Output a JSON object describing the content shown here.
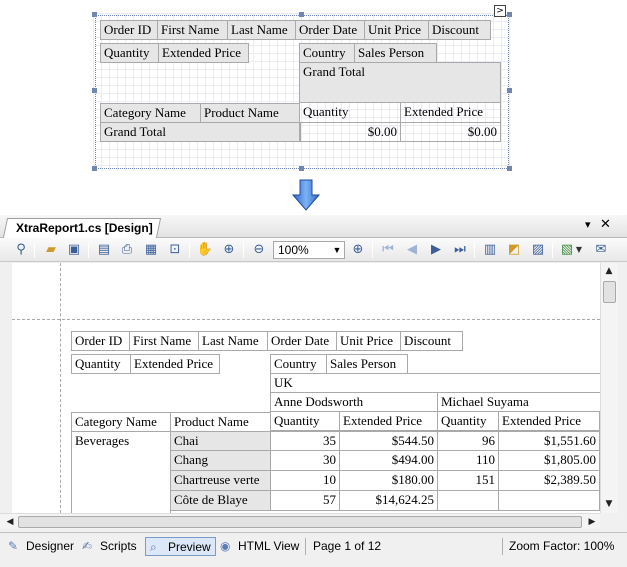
{
  "designer": {
    "table1": [
      "Order ID",
      "First Name",
      "Last Name",
      "Order Date",
      "Unit Price",
      "Discount"
    ],
    "detail_left": [
      "Quantity",
      "Extended Price"
    ],
    "pivot_cols": [
      "Country",
      "Sales Person"
    ],
    "grand_total_col": "Grand Total",
    "row_headers": [
      "Category Name",
      "Product Name"
    ],
    "data_headers": [
      "Quantity",
      "Extended Price"
    ],
    "grand_total_row": "Grand Total",
    "totals": [
      "$0.00",
      "$0.00"
    ]
  },
  "window": {
    "tab_title": "XtraReport1.cs [Design]",
    "zoom": "100%",
    "close": "✕",
    "pin": "▾"
  },
  "preview": {
    "table1": [
      "Order ID",
      "First Name",
      "Last Name",
      "Order Date",
      "Unit Price",
      "Discount"
    ],
    "detail_left": [
      "Quantity",
      "Extended Price"
    ],
    "pivot_cols": [
      "Country",
      "Sales Person"
    ],
    "country": "UK",
    "sales_persons": [
      "Anne Dodsworth",
      "Michael Suyama"
    ],
    "row_headers": [
      "Category Name",
      "Product Name"
    ],
    "data_headers": [
      "Quantity",
      "Extended Price",
      "Quantity",
      "Extended Price"
    ],
    "category": "Beverages",
    "rows": [
      {
        "product": "Chai",
        "q1": "35",
        "e1": "$544.50",
        "q2": "96",
        "e2": "$1,551.60"
      },
      {
        "product": "Chang",
        "q1": "30",
        "e1": "$494.00",
        "q2": "110",
        "e2": "$1,805.00"
      },
      {
        "product": "Chartreuse verte",
        "q1": "10",
        "e1": "$180.00",
        "q2": "151",
        "e2": "$2,389.50"
      },
      {
        "product": "Côte de Blaye",
        "q1": "57",
        "e1": "$14,624.25",
        "q2": "",
        "e2": ""
      }
    ]
  },
  "statusbar": {
    "designer": "Designer",
    "scripts": "Scripts",
    "preview": "Preview",
    "html_view": "HTML View",
    "page": "Page 1 of 12",
    "zoom_factor": "Zoom Factor: 100%"
  }
}
